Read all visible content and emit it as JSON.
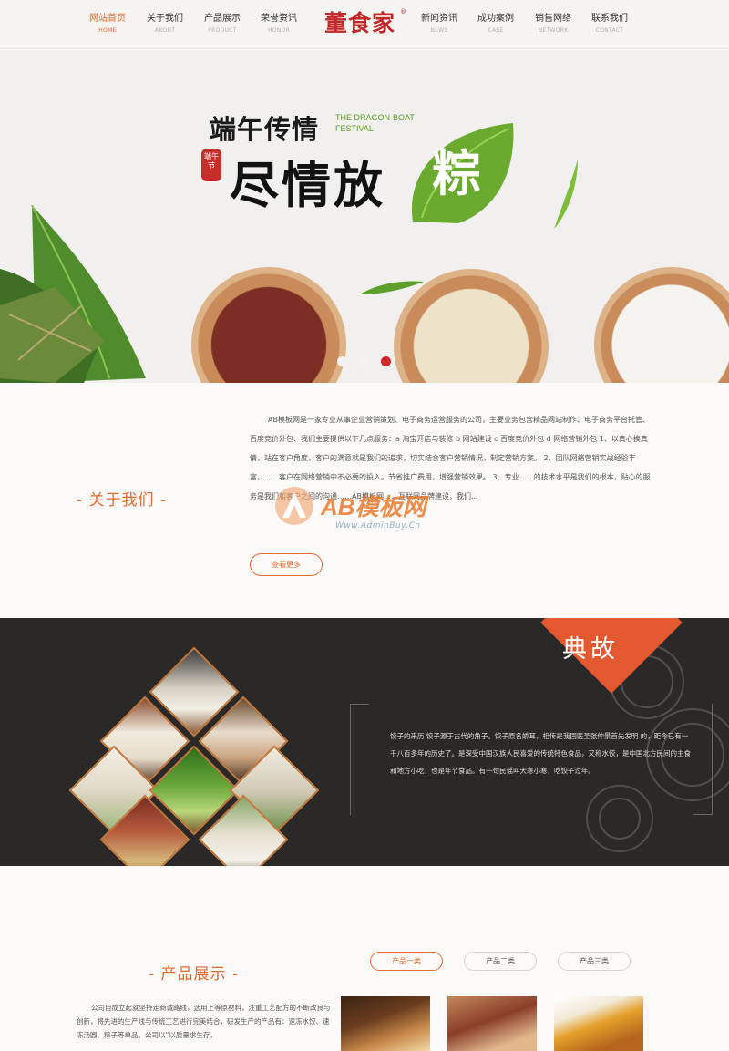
{
  "nav": {
    "items": [
      {
        "zh": "网站首页",
        "en": "HOME"
      },
      {
        "zh": "关于我们",
        "en": "ABOUT"
      },
      {
        "zh": "产品展示",
        "en": "PRODUCT"
      },
      {
        "zh": "荣誉资讯",
        "en": "HONOR"
      },
      {
        "zh": "新闻资讯",
        "en": "NEWS"
      },
      {
        "zh": "成功案例",
        "en": "CASE"
      },
      {
        "zh": "销售网络",
        "en": "NETWORK"
      },
      {
        "zh": "联系我们",
        "en": "CONTACT"
      }
    ],
    "active_index": 0,
    "logo": "董食家",
    "logo_mark": "®"
  },
  "banner": {
    "slogan_top": "端午传情",
    "slogan_main": "尽情放",
    "zongzi_char": "粽",
    "en_title_line1": "THE DRAGON-BOAT",
    "en_title_line2": "FESTIVAL",
    "seal": "端午节",
    "slides": 3,
    "active_slide": 2
  },
  "about": {
    "title": "-  关于我们  -",
    "text": "AB模板网是一家专业从事企业营销策划、电子商务运营服务的公司，主要业务包含精品网站制作、电子商务平台托管、百度竞价外包、我们主要提供以下几点服务：a 淘宝开店与装修 b 网站建设 c 百度竞价外包 d 网络营销外包 1、以真心换真情，站在客户角度，客户的满意就是我们的追求，切实结合客户营销情况，制定营销方案。 2、团队网络营销实战经验丰富，……客户在网络营销中不必要的投入。节省推广费用，增强营销效果。 3、专业……的技术水平是我们的根本，贴心的服务是我们和客户之间的沟通……AB模板网……互联网品牌建设，我们...",
    "more_label": "查看更多",
    "watermark_text": "AB模板网",
    "watermark_url": "Www.AdminBuy.Cn"
  },
  "story": {
    "badge": "典故",
    "text": "饺子的来历 饺子源于古代的角子。饺子原名娇耳，相传是我国医圣张仲景首先发明 的，距今已有一千八百多年的历史了。是深受中国汉族人民喜爱的传统特色食品，又称水饺，是中国北方民间的主食和地方小吃，也是年节食品。有一句民谣叫大寒小寒，吃饺子过年。"
  },
  "products": {
    "title": "-  产品展示  -",
    "tabs": [
      "产品一类",
      "产品二类",
      "产品三类"
    ],
    "active_tab": 0,
    "text": "公司自成立起就坚持走商诚路线，选用上等原材料，注重工艺配方的不断改良与创新，将先进的生产线与传统工艺进行完美结合，研发生产的产品有：速冻水饺、速冻汤圆、粽子等单品。公司以“以质量求生存，"
  },
  "colors": {
    "accent": "#e76a2f",
    "logo_red": "#c0282a",
    "dark_bg": "#2a2928",
    "leaf_green": "#6aaa2e"
  }
}
